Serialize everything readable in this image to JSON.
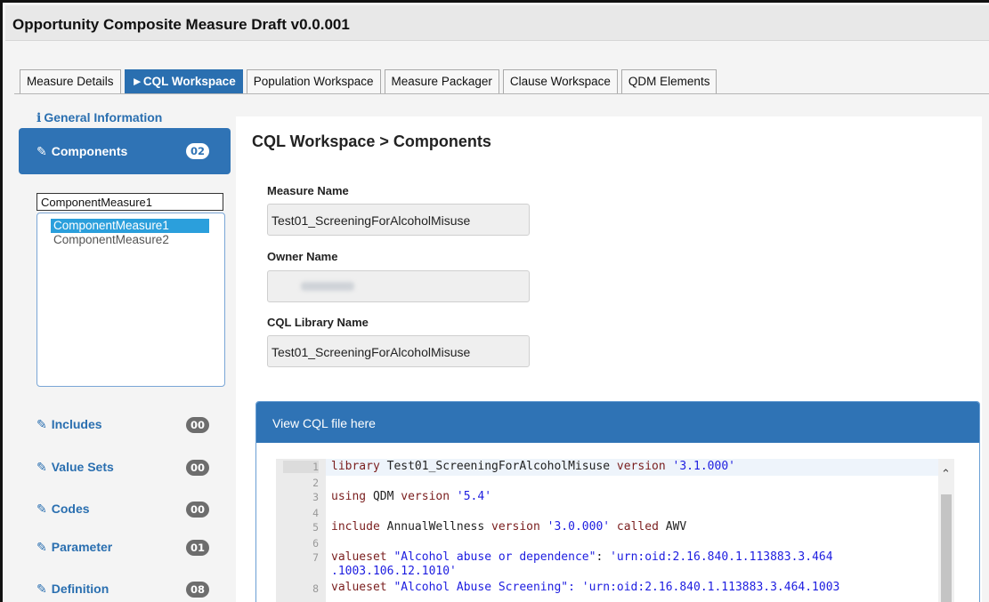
{
  "window": {
    "title": "Opportunity Composite Measure Draft v0.0.001"
  },
  "tabs": [
    {
      "label": "Measure Details",
      "active": false
    },
    {
      "label": "►CQL Workspace",
      "active": true
    },
    {
      "label": "Population Workspace",
      "active": false
    },
    {
      "label": "Measure Packager",
      "active": false
    },
    {
      "label": "Clause Workspace",
      "active": false
    },
    {
      "label": "QDM Elements",
      "active": false
    }
  ],
  "sidebar": {
    "general_info": "General Information",
    "components": {
      "label": "Components",
      "count": "02"
    },
    "component_input_value": "ComponentMeasure1",
    "component_list": [
      {
        "label": "ComponentMeasure1",
        "selected": true
      },
      {
        "label": "ComponentMeasure2",
        "selected": false
      }
    ],
    "items": [
      {
        "label": "Includes",
        "count": "00"
      },
      {
        "label": "Value Sets",
        "count": "00"
      },
      {
        "label": "Codes",
        "count": "00"
      },
      {
        "label": "Parameter",
        "count": "01"
      },
      {
        "label": "Definition",
        "count": "08"
      }
    ]
  },
  "main": {
    "breadcrumb": "CQL Workspace > Components",
    "measure_name_label": "Measure Name",
    "measure_name_value": "Test01_ScreeningForAlcoholMisuse",
    "owner_name_label": "Owner Name",
    "cql_library_label": "CQL Library Name",
    "cql_library_value": "Test01_ScreeningForAlcoholMisuse",
    "cql_panel_title": "View CQL file here",
    "line_numbers": [
      "1",
      "2",
      "3",
      "4",
      "5",
      "6",
      "7",
      "",
      "8"
    ],
    "code": {
      "l1_kw": "library",
      "l1_name": " Test01_ScreeningForAlcoholMisuse ",
      "l1_kw2": "version",
      "l1_str": " '3.1.000'",
      "l3_kw": "using",
      "l3_name": " QDM ",
      "l3_kw2": "version",
      "l3_str": " '5.4'",
      "l5_kw": "include",
      "l5_name": " AnnualWellness ",
      "l5_kw2": "version",
      "l5_str": " '3.0.000'",
      "l5_kw3": " called",
      "l5_alias": " AWV",
      "l7_kw": "valueset",
      "l7_str": " \"Alcohol abuse or dependence\"",
      "l7_plain": ": ",
      "l7_oid": "'urn:oid:2.16.840.1.113883.3.464",
      "l7b_oid": ".1003.106.12.1010'",
      "l8_kw": "valueset",
      "l8_str": " \"Alcohol Abuse Screening\": 'urn:oid:2.16.840.1.113883.3.464.1003"
    }
  }
}
